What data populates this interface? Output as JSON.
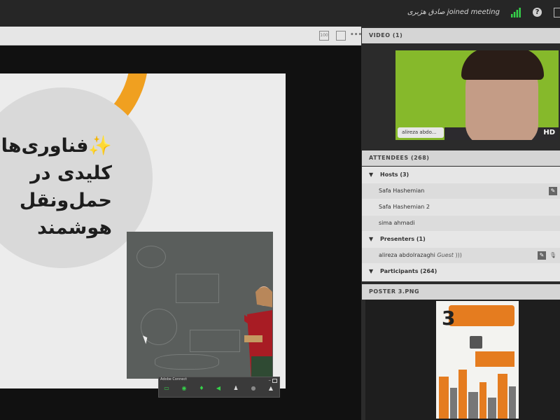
{
  "topbar": {
    "notice_name": "صادق هژبری",
    "notice_text": "joined meeting",
    "signal_icon": "signal-bars-icon",
    "help_icon": "help-icon",
    "help_glyph": "?",
    "fullscreen_icon": "fullscreen-icon"
  },
  "share_toolbar": {
    "icons": [
      "zoom-100-icon",
      "fit-screen-icon",
      "more-options-icon"
    ]
  },
  "slide": {
    "title_line1": "✨فناوری‌های",
    "title_line2": "کلیدی در",
    "title_line3": "حمل‌ونقل",
    "title_line4": "هوشمند"
  },
  "adobe_bar": {
    "label": "Adobe Connect",
    "icons": [
      "share-screen-icon",
      "webcam-icon",
      "microphone-icon",
      "speaker-icon",
      "attendee-status-icon",
      "chat-icon",
      "notification-icon"
    ]
  },
  "video_pod": {
    "header": "VIDEO (1)",
    "name_tag": "alireza abdo...",
    "quality": "HD"
  },
  "attendees": {
    "header": "ATTENDEES (268)",
    "hosts_label": "Hosts (3)",
    "hosts": [
      {
        "name": "Safa Hashemian"
      },
      {
        "name": "Safa Hashemian 2"
      },
      {
        "name": "sima ahmadi"
      }
    ],
    "presenters_label": "Presenters (1)",
    "presenters": [
      {
        "name": "alireza abdolrazaghi",
        "role": "Guest"
      }
    ],
    "participants_label": "Participants (264)"
  },
  "poster_pod": {
    "header": "POSTER 3.PNG",
    "big_number": "3"
  },
  "colors": {
    "accent_orange": "#f0a020",
    "green_icon": "#36d14a",
    "video_bg": "#86b92b"
  }
}
